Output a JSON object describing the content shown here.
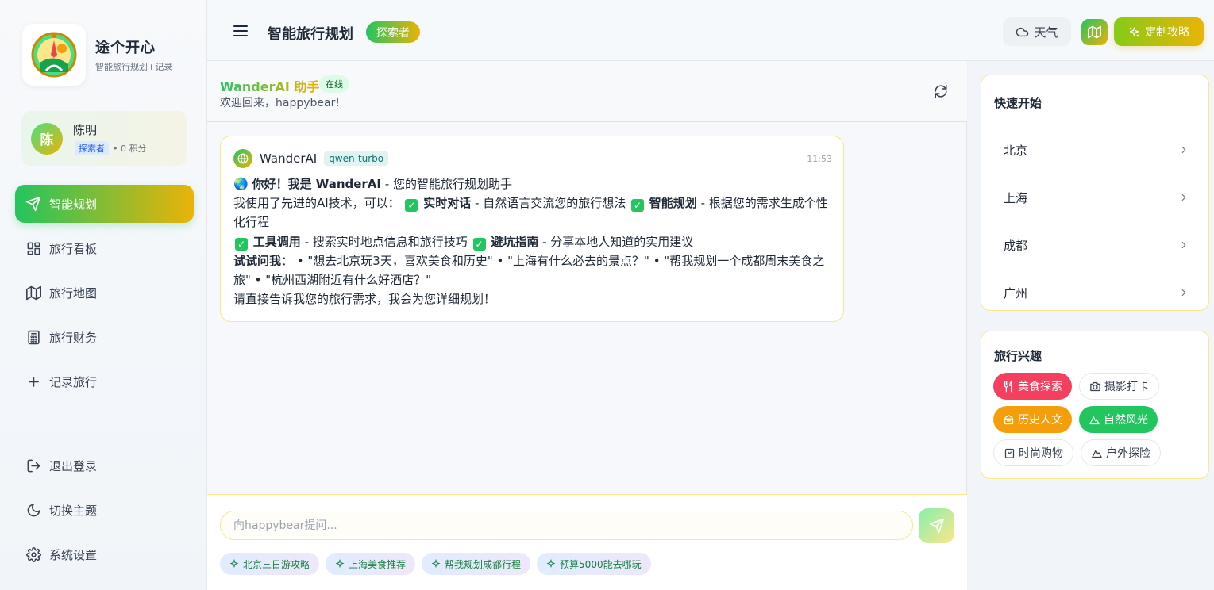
{
  "brand": {
    "name": "途个开心",
    "subtitle": "智能旅行规划+记录"
  },
  "user": {
    "avatar": "陈",
    "name": "陈明",
    "level": "探索者",
    "points": "• 0 积分"
  },
  "nav": {
    "items": [
      {
        "label": "智能规划",
        "icon": "send-icon",
        "active": true
      },
      {
        "label": "旅行看板",
        "icon": "grid-icon"
      },
      {
        "label": "旅行地图",
        "icon": "map-icon"
      },
      {
        "label": "旅行财务",
        "icon": "calculator-icon"
      },
      {
        "label": "记录旅行",
        "icon": "plus-icon"
      }
    ],
    "bottom": [
      {
        "label": "退出登录",
        "icon": "logout-icon"
      },
      {
        "label": "切换主题",
        "icon": "moon-icon"
      },
      {
        "label": "系统设置",
        "icon": "gear-icon"
      }
    ]
  },
  "header": {
    "title": "智能旅行规划",
    "badge": "探索者",
    "weather_label": "天气",
    "custom_label": "定制攻略"
  },
  "chat": {
    "assistant_name": "WanderAI 助手",
    "status": "在线",
    "welcome": "欢迎回来，happybear!",
    "message": {
      "sender": "WanderAI",
      "model": "qwen-turbo",
      "time": "11:53",
      "greeting_bold": "你好！我是 WanderAI",
      "greeting_rest": " - 您的智能旅行规划助手",
      "intro": "我使用了先进的AI技术，可以：",
      "f1_title": "实时对话",
      "f1_desc": " - 自然语言交流您的旅行想法",
      "f2_title": "智能规划",
      "f2_desc": " - 根据您的需求生成个性化行程",
      "f3_title": "工具调用",
      "f3_desc": " - 搜索实时地点信息和旅行技巧",
      "f4_title": "避坑指南",
      "f4_desc": " - 分享本地人知道的实用建议",
      "try_title": "试试问我",
      "try_text": "： • \"想去北京玩3天，喜欢美食和历史\" • \"上海有什么必去的景点？\" • \"帮我规划一个成都周末美食之旅\" • \"杭州西湖附近有什么好酒店？\"",
      "closing": "请直接告诉我您的旅行需求，我会为您详细规划！"
    },
    "input_placeholder": "向happybear提问...",
    "suggestions": [
      "北京三日游攻略",
      "上海美食推荐",
      "帮我规划成都行程",
      "预算5000能去哪玩"
    ]
  },
  "quick_start": {
    "title": "快速开始",
    "cities": [
      "北京",
      "上海",
      "成都",
      "广州"
    ]
  },
  "interests": {
    "title": "旅行兴趣",
    "tags": [
      {
        "label": "美食探索",
        "icon": "utensils-icon",
        "color": "#f43f5e",
        "filled": true
      },
      {
        "label": "摄影打卡",
        "icon": "camera-icon",
        "filled": false
      },
      {
        "label": "历史人文",
        "icon": "landmark-icon",
        "color": "#f59e0b",
        "filled": true
      },
      {
        "label": "自然风光",
        "icon": "mountain-icon",
        "color": "#22c55e",
        "filled": true
      },
      {
        "label": "时尚购物",
        "icon": "bag-icon",
        "filled": false
      },
      {
        "label": "户外探险",
        "icon": "mountain-icon",
        "filled": false
      }
    ]
  },
  "colors": {
    "accent_green": "#22c55e",
    "accent_yellow": "#eab308",
    "border_yellow": "#fde68a"
  }
}
